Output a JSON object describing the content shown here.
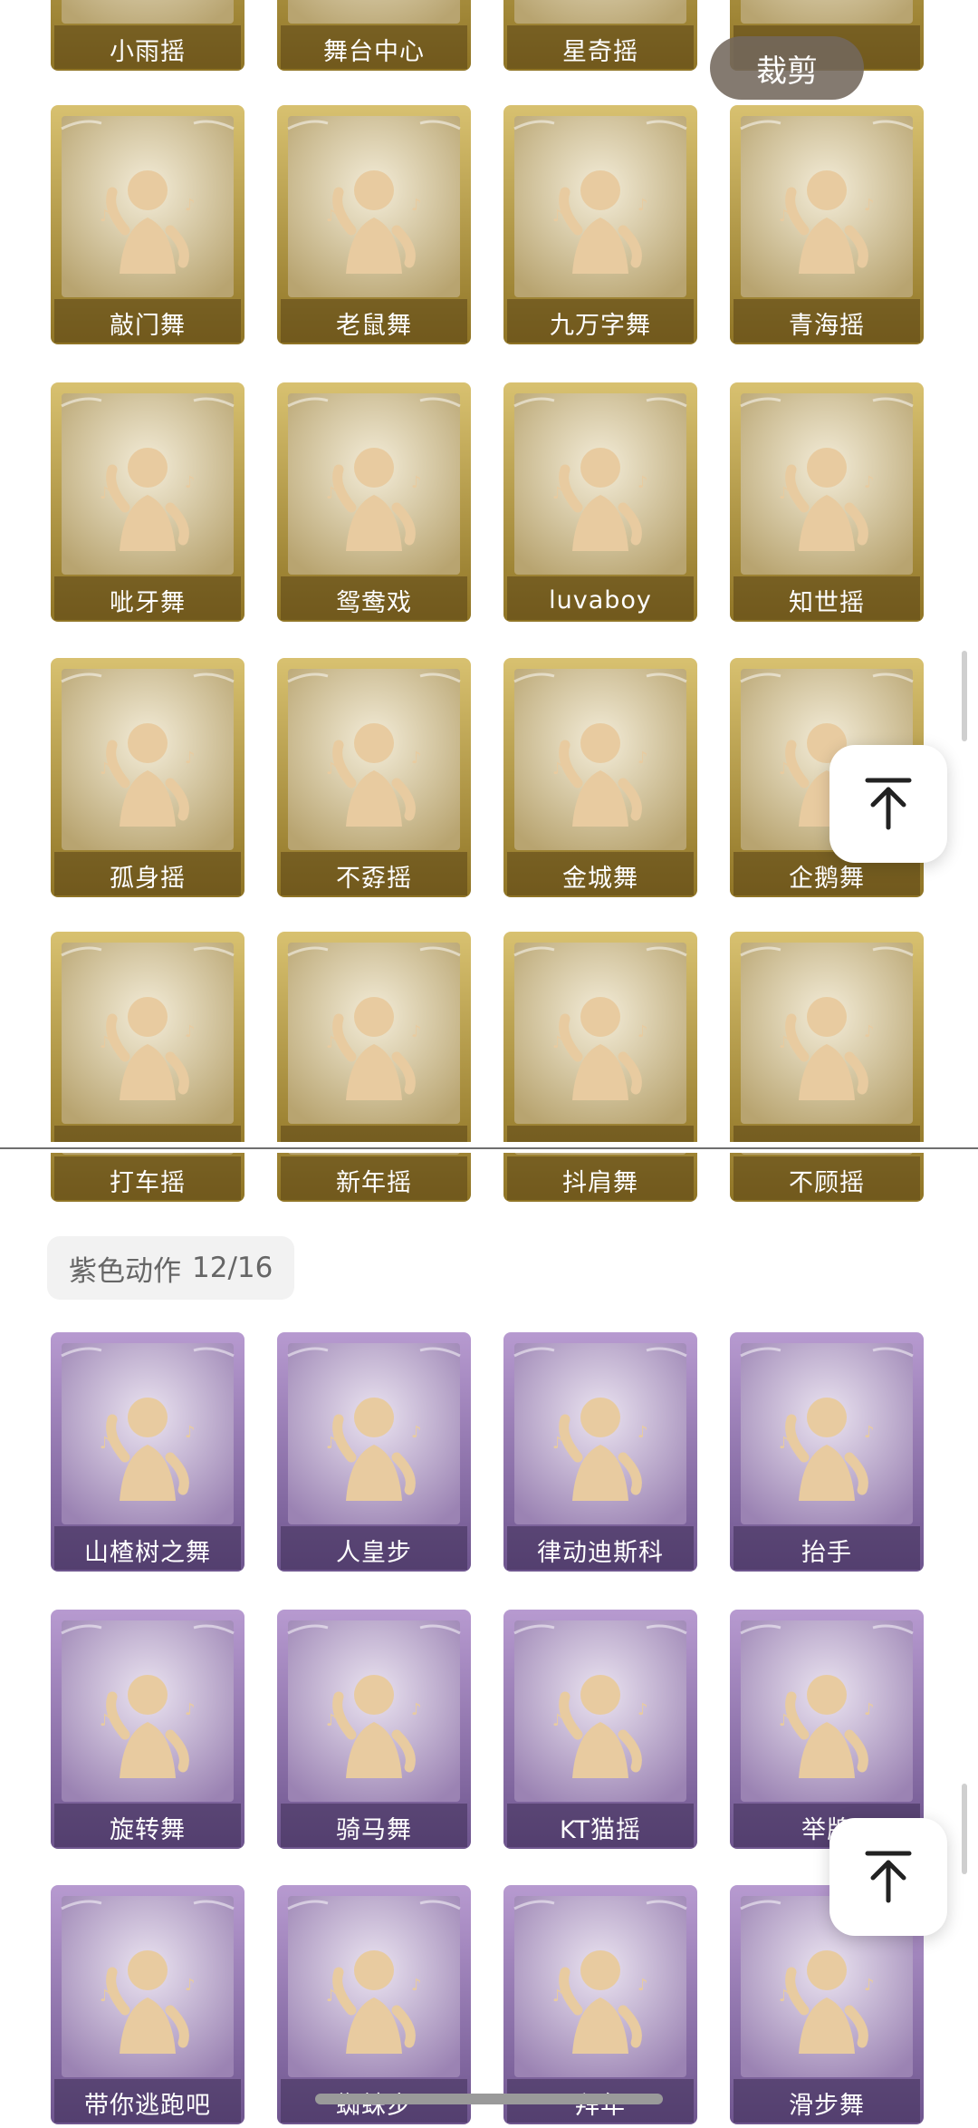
{
  "crop_button": "裁剪",
  "section_purple": {
    "title": "紫色动作",
    "count": "12/16"
  },
  "cards_gold": [
    {
      "label": "小雨摇",
      "icon": "dance-pose-icon"
    },
    {
      "label": "舞台中心",
      "icon": "dance-pose-icon"
    },
    {
      "label": "星奇摇",
      "icon": "dance-pose-icon"
    },
    {
      "label": "",
      "icon": "dance-pose-icon"
    },
    {
      "label": "敲门舞",
      "icon": "dance-pose-icon"
    },
    {
      "label": "老鼠舞",
      "icon": "dance-pose-icon"
    },
    {
      "label": "九万字舞",
      "icon": "dance-pose-icon"
    },
    {
      "label": "青海摇",
      "icon": "dance-pose-icon"
    },
    {
      "label": "呲牙舞",
      "icon": "dance-pose-icon"
    },
    {
      "label": "鸳鸯戏",
      "icon": "dance-pose-icon"
    },
    {
      "label": "luvaboy",
      "icon": "dance-pose-icon"
    },
    {
      "label": "知世摇",
      "icon": "dance-pose-icon"
    },
    {
      "label": "孤身摇",
      "icon": "dance-pose-icon"
    },
    {
      "label": "不孬摇",
      "icon": "dance-pose-icon"
    },
    {
      "label": "金城舞",
      "icon": "dance-pose-icon"
    },
    {
      "label": "企鹅舞",
      "icon": "dance-pose-icon"
    },
    {
      "label": "",
      "icon": "dance-pose-icon"
    },
    {
      "label": "",
      "icon": "dance-pose-icon"
    },
    {
      "label": "",
      "icon": "dance-pose-icon"
    },
    {
      "label": "",
      "icon": "dance-pose-icon"
    },
    {
      "label": "打车摇",
      "icon": "dance-pose-icon"
    },
    {
      "label": "新年摇",
      "icon": "dance-pose-icon"
    },
    {
      "label": "抖肩舞",
      "icon": "dance-pose-icon"
    },
    {
      "label": "不顾摇",
      "icon": "dance-pose-icon"
    }
  ],
  "cards_purple": [
    {
      "label": "山楂树之舞",
      "icon": "dance-pose-icon"
    },
    {
      "label": "人皇步",
      "icon": "dance-pose-icon"
    },
    {
      "label": "律动迪斯科",
      "icon": "dance-pose-icon"
    },
    {
      "label": "抬手",
      "icon": "dance-pose-icon"
    },
    {
      "label": "旋转舞",
      "icon": "dance-pose-icon"
    },
    {
      "label": "骑马舞",
      "icon": "dance-pose-icon"
    },
    {
      "label": "KT猫摇",
      "icon": "dance-pose-icon"
    },
    {
      "label": "举牌",
      "icon": "dance-pose-icon"
    },
    {
      "label": "带你逃跑吧",
      "icon": "dance-pose-icon"
    },
    {
      "label": "蜘蛛步",
      "icon": "dance-pose-icon"
    },
    {
      "label": "拜年",
      "icon": "dance-pose-icon"
    },
    {
      "label": "滑步舞",
      "icon": "dance-pose-icon"
    }
  ],
  "icons": {
    "back_to_top": "arrow-up-to-top-icon"
  },
  "colors": {
    "gold_frame": "#b89a3c",
    "purple_frame": "#9a7bb5",
    "figure": "#e8cba0"
  }
}
